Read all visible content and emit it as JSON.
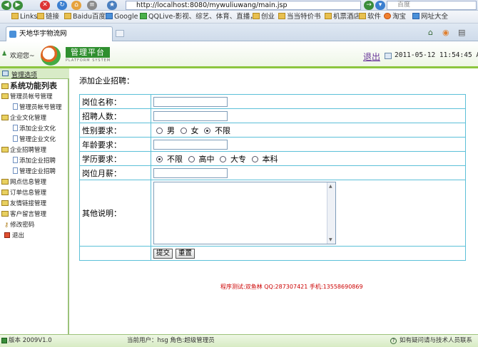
{
  "browser": {
    "address": "http://localhost:8080/mywuliuwang/main.jsp",
    "search_placeholder": "百度",
    "favorites": [
      "Links",
      "链接",
      "Baidu百度",
      "Google",
      "QQLive-影视、综艺、体育、直播，...",
      "创业",
      "当当特价书",
      "机票酒店",
      "软件",
      "淘宝",
      "网址大全"
    ],
    "tab_title": "天地华宇物流网"
  },
  "header": {
    "welcome": "欢迎您~",
    "brand": "管理平台",
    "brand_sub": "PLATFORM SYSTEM",
    "logout": "退出",
    "datetime": "2011-05-12 11:54:45 AM"
  },
  "sidebar": {
    "title": "管理选项",
    "root": "系统功能列表",
    "items": [
      {
        "label": "管理员帐号管理",
        "type": "folder",
        "level": 1
      },
      {
        "label": "管理员帐号管理",
        "type": "doc",
        "level": 2
      },
      {
        "label": "企业文化管理",
        "type": "folder",
        "level": 1
      },
      {
        "label": "添加企业文化",
        "type": "doc",
        "level": 2
      },
      {
        "label": "管理企业文化",
        "type": "doc",
        "level": 2
      },
      {
        "label": "企业招聘管理",
        "type": "folder",
        "level": 1
      },
      {
        "label": "添加企业招聘",
        "type": "doc",
        "level": 2
      },
      {
        "label": "管理企业招聘",
        "type": "doc",
        "level": 2
      },
      {
        "label": "网点信息管理",
        "type": "folder",
        "level": 1
      },
      {
        "label": "订单信息管理",
        "type": "folder",
        "level": 1
      },
      {
        "label": "友情链接管理",
        "type": "folder",
        "level": 1
      },
      {
        "label": "客户留言管理",
        "type": "folder",
        "level": 1
      },
      {
        "label": "修改密码",
        "type": "key",
        "level": 1
      },
      {
        "label": "退出",
        "type": "exit",
        "level": 1
      }
    ]
  },
  "form": {
    "title": "添加企业招聘：",
    "labels": {
      "position": "岗位名称：",
      "count": "招聘人数：",
      "gender": "性别要求：",
      "age": "年龄要求：",
      "education": "学历要求：",
      "salary": "岗位月薪：",
      "other": "其他说明："
    },
    "gender_options": [
      "男",
      "女",
      "不限"
    ],
    "gender_selected": "不限",
    "education_options": [
      "不限",
      "高中",
      "大专",
      "本科"
    ],
    "education_selected": "不限",
    "submit": "提交",
    "reset": "重置"
  },
  "credit": "程序测试:双鱼林 QQ:287307421 手机:13558690869",
  "footer": {
    "version": "版本 2009V1.0",
    "user": "当前用户：hsg  角色:超级管理员",
    "help": "如有疑问请与技术人员联系"
  },
  "colors": {
    "accent_green": "#8cc63f",
    "table_border": "#5cc0d8",
    "credit_red": "#cc0000",
    "logout_purple": "#663399"
  }
}
